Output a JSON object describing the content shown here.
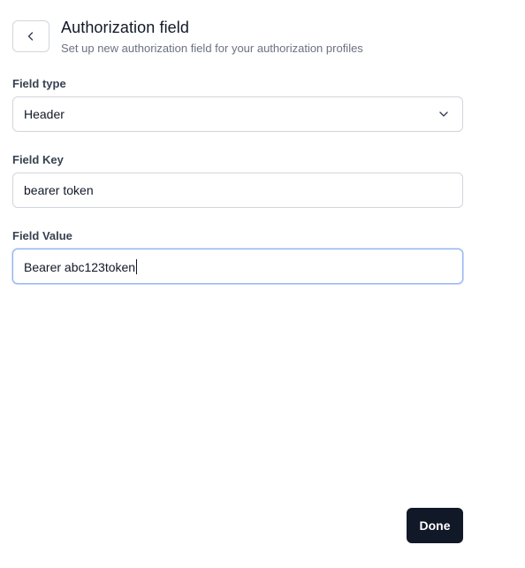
{
  "header": {
    "title": "Authorization field",
    "subtitle": "Set up new authorization field for your authorization profiles",
    "back_icon": "chevron-left-icon"
  },
  "form": {
    "field_type": {
      "label": "Field type",
      "value": "Header",
      "icon": "chevron-down-icon"
    },
    "field_key": {
      "label": "Field Key",
      "value": "bearer token"
    },
    "field_value": {
      "label": "Field Value",
      "value": "Bearer abc123token",
      "focused": true
    }
  },
  "actions": {
    "done_label": "Done"
  },
  "colors": {
    "primary_button": "#111827",
    "focus_border": "#93b4f5",
    "border": "#d1d5db",
    "muted_text": "#6b7280"
  }
}
